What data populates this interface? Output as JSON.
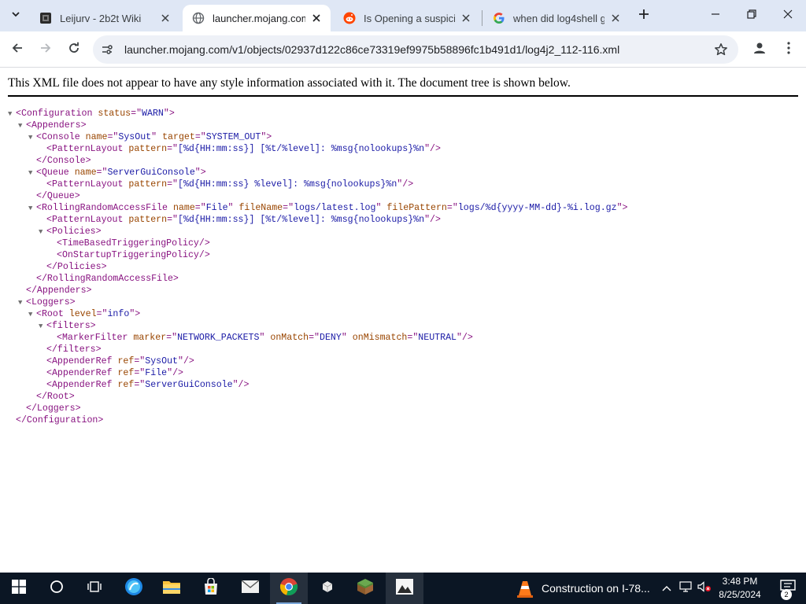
{
  "browser": {
    "tabs": [
      {
        "title": "Leijurv - 2b2t Wiki",
        "active": false
      },
      {
        "title": "launcher.mojang.com/",
        "active": true
      },
      {
        "title": "Is Opening a suspiciou",
        "active": false
      },
      {
        "title": "when did log4shell ge",
        "active": false
      }
    ],
    "url": "launcher.mojang.com/v1/objects/02937d122c86ce73319ef9975b58896fc1b491d1/log4j2_112-116.xml"
  },
  "page": {
    "info": "This XML file does not appear to have any style information associated with it. The document tree is shown below.",
    "tree": [
      {
        "indent": 0,
        "toggle": true,
        "parts": [
          [
            "t",
            "<Configuration"
          ],
          [
            "n",
            " status"
          ],
          [
            "t",
            "=\""
          ],
          [
            "v",
            "WARN"
          ],
          [
            "t",
            "\">"
          ]
        ]
      },
      {
        "indent": 1,
        "toggle": true,
        "parts": [
          [
            "t",
            "<Appenders>"
          ]
        ]
      },
      {
        "indent": 2,
        "toggle": true,
        "parts": [
          [
            "t",
            "<Console"
          ],
          [
            "n",
            " name"
          ],
          [
            "t",
            "=\""
          ],
          [
            "v",
            "SysOut"
          ],
          [
            "t",
            "\""
          ],
          [
            "n",
            " target"
          ],
          [
            "t",
            "=\""
          ],
          [
            "v",
            "SYSTEM_OUT"
          ],
          [
            "t",
            "\">"
          ]
        ]
      },
      {
        "indent": 3,
        "toggle": false,
        "parts": [
          [
            "t",
            "<PatternLayout"
          ],
          [
            "n",
            " pattern"
          ],
          [
            "t",
            "=\""
          ],
          [
            "v",
            "[%d{HH:mm:ss}] [%t/%level]: %msg{nolookups}%n"
          ],
          [
            "t",
            "\"/>"
          ]
        ]
      },
      {
        "indent": 2,
        "toggle": false,
        "parts": [
          [
            "t",
            "</Console>"
          ]
        ]
      },
      {
        "indent": 2,
        "toggle": true,
        "parts": [
          [
            "t",
            "<Queue"
          ],
          [
            "n",
            " name"
          ],
          [
            "t",
            "=\""
          ],
          [
            "v",
            "ServerGuiConsole"
          ],
          [
            "t",
            "\">"
          ]
        ]
      },
      {
        "indent": 3,
        "toggle": false,
        "parts": [
          [
            "t",
            "<PatternLayout"
          ],
          [
            "n",
            " pattern"
          ],
          [
            "t",
            "=\""
          ],
          [
            "v",
            "[%d{HH:mm:ss} %level]: %msg{nolookups}%n"
          ],
          [
            "t",
            "\"/>"
          ]
        ]
      },
      {
        "indent": 2,
        "toggle": false,
        "parts": [
          [
            "t",
            "</Queue>"
          ]
        ]
      },
      {
        "indent": 2,
        "toggle": true,
        "parts": [
          [
            "t",
            "<RollingRandomAccessFile"
          ],
          [
            "n",
            " name"
          ],
          [
            "t",
            "=\""
          ],
          [
            "v",
            "File"
          ],
          [
            "t",
            "\""
          ],
          [
            "n",
            " fileName"
          ],
          [
            "t",
            "=\""
          ],
          [
            "v",
            "logs/latest.log"
          ],
          [
            "t",
            "\""
          ],
          [
            "n",
            " filePattern"
          ],
          [
            "t",
            "=\""
          ],
          [
            "v",
            "logs/%d{yyyy-MM-dd}-%i.log.gz"
          ],
          [
            "t",
            "\">"
          ]
        ]
      },
      {
        "indent": 3,
        "toggle": false,
        "parts": [
          [
            "t",
            "<PatternLayout"
          ],
          [
            "n",
            " pattern"
          ],
          [
            "t",
            "=\""
          ],
          [
            "v",
            "[%d{HH:mm:ss}] [%t/%level]: %msg{nolookups}%n"
          ],
          [
            "t",
            "\"/>"
          ]
        ]
      },
      {
        "indent": 3,
        "toggle": true,
        "parts": [
          [
            "t",
            "<Policies>"
          ]
        ]
      },
      {
        "indent": 4,
        "toggle": false,
        "parts": [
          [
            "t",
            "<TimeBasedTriggeringPolicy/>"
          ]
        ]
      },
      {
        "indent": 4,
        "toggle": false,
        "parts": [
          [
            "t",
            "<OnStartupTriggeringPolicy/>"
          ]
        ]
      },
      {
        "indent": 3,
        "toggle": false,
        "parts": [
          [
            "t",
            "</Policies>"
          ]
        ]
      },
      {
        "indent": 2,
        "toggle": false,
        "parts": [
          [
            "t",
            "</RollingRandomAccessFile>"
          ]
        ]
      },
      {
        "indent": 1,
        "toggle": false,
        "parts": [
          [
            "t",
            "</Appenders>"
          ]
        ]
      },
      {
        "indent": 1,
        "toggle": true,
        "parts": [
          [
            "t",
            "<Loggers>"
          ]
        ]
      },
      {
        "indent": 2,
        "toggle": true,
        "parts": [
          [
            "t",
            "<Root"
          ],
          [
            "n",
            " level"
          ],
          [
            "t",
            "=\""
          ],
          [
            "v",
            "info"
          ],
          [
            "t",
            "\">"
          ]
        ]
      },
      {
        "indent": 3,
        "toggle": true,
        "parts": [
          [
            "t",
            "<filters>"
          ]
        ]
      },
      {
        "indent": 4,
        "toggle": false,
        "parts": [
          [
            "t",
            "<MarkerFilter"
          ],
          [
            "n",
            " marker"
          ],
          [
            "t",
            "=\""
          ],
          [
            "v",
            "NETWORK_PACKETS"
          ],
          [
            "t",
            "\""
          ],
          [
            "n",
            " onMatch"
          ],
          [
            "t",
            "=\""
          ],
          [
            "v",
            "DENY"
          ],
          [
            "t",
            "\""
          ],
          [
            "n",
            " onMismatch"
          ],
          [
            "t",
            "=\""
          ],
          [
            "v",
            "NEUTRAL"
          ],
          [
            "t",
            "\"/>"
          ]
        ]
      },
      {
        "indent": 3,
        "toggle": false,
        "parts": [
          [
            "t",
            "</filters>"
          ]
        ]
      },
      {
        "indent": 3,
        "toggle": false,
        "parts": [
          [
            "t",
            "<AppenderRef"
          ],
          [
            "n",
            " ref"
          ],
          [
            "t",
            "=\""
          ],
          [
            "v",
            "SysOut"
          ],
          [
            "t",
            "\"/>"
          ]
        ]
      },
      {
        "indent": 3,
        "toggle": false,
        "parts": [
          [
            "t",
            "<AppenderRef"
          ],
          [
            "n",
            " ref"
          ],
          [
            "t",
            "=\""
          ],
          [
            "v",
            "File"
          ],
          [
            "t",
            "\"/>"
          ]
        ]
      },
      {
        "indent": 3,
        "toggle": false,
        "parts": [
          [
            "t",
            "<AppenderRef"
          ],
          [
            "n",
            " ref"
          ],
          [
            "t",
            "=\""
          ],
          [
            "v",
            "ServerGuiConsole"
          ],
          [
            "t",
            "\"/>"
          ]
        ]
      },
      {
        "indent": 2,
        "toggle": false,
        "parts": [
          [
            "t",
            "</Root>"
          ]
        ]
      },
      {
        "indent": 1,
        "toggle": false,
        "parts": [
          [
            "t",
            "</Loggers>"
          ]
        ]
      },
      {
        "indent": 0,
        "toggle": false,
        "parts": [
          [
            "t",
            "</Configuration>"
          ]
        ]
      }
    ]
  },
  "taskbar": {
    "news": "Construction on I-78...",
    "time": "3:48 PM",
    "date": "8/25/2024",
    "notification_count": "2"
  },
  "colors": {
    "tag": "#881280",
    "attr_name": "#994500",
    "attr_value": "#1a1aa6",
    "tabstrip": "#dfe7f5",
    "taskbar": "#0b1624"
  }
}
